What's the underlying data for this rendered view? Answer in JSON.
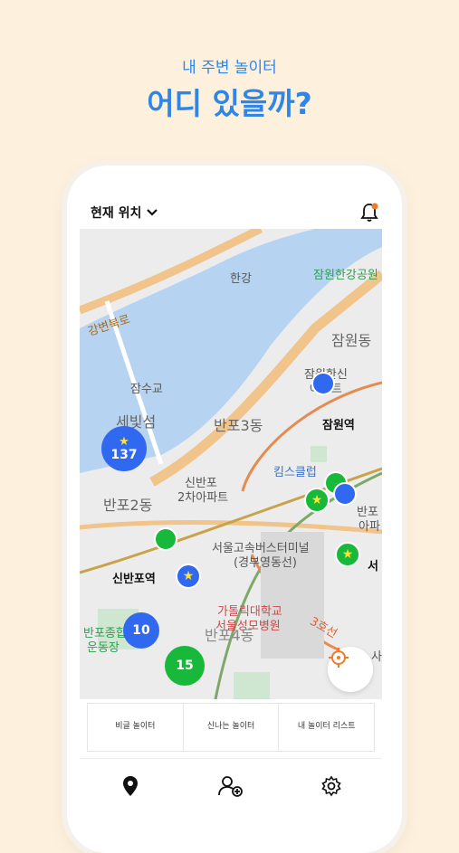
{
  "header": {
    "subtitle": "내 주변 놀이터",
    "headline": "어디 있을까?"
  },
  "app": {
    "location_label": "현재 위치"
  },
  "map": {
    "labels": {
      "hangang": "한강",
      "park_hangang": "잠원한강공원",
      "gangbyeon_road": "강변북로",
      "jamwon_dong": "잠원동",
      "jamwon_apt": "잠원한신",
      "jamwon_apt2": "아파트",
      "jamsugyo": "잠수교",
      "sebitseom": "세빛섬",
      "banpo3dong": "반포3동",
      "jamwon_station": "잠원역",
      "kids_club": "킴스클럽",
      "sinbanpo_apt": "신반포",
      "sinbanpo_apt2": "2차아파트",
      "banpo2dong": "반포2동",
      "banpo_apt_r": "반포",
      "banpo_apt_r2": "아파",
      "bus_terminal": "서울고속버스터미널",
      "bus_terminal2": "(경부영동선)",
      "sinbanpo_station": "신반포역",
      "catholic_univ": "가톨릭대학교",
      "catholic_hosp": "서울성모병원",
      "banpo4dong": "반포4동",
      "line3": "3호선",
      "banpo_sports": "반포종합",
      "banpo_sports2": "운동장",
      "side_s": "서",
      "side_a": "사"
    },
    "clusters": [
      {
        "count": "137",
        "color": "blue",
        "starred": true
      },
      {
        "count": "10",
        "color": "blue",
        "starred": false
      },
      {
        "count": "15",
        "color": "green",
        "starred": false
      }
    ]
  },
  "filters": [
    {
      "label": "비글 놀이터"
    },
    {
      "label": "신나는 놀이터"
    },
    {
      "label": "내 놀이터 리스트"
    }
  ],
  "nav": {
    "items": [
      {
        "icon": "location-pin-icon"
      },
      {
        "icon": "add-friend-icon"
      },
      {
        "icon": "settings-gear-icon"
      }
    ]
  },
  "colors": {
    "accent": "#2f86e8",
    "blue_marker": "#3168f0",
    "green_marker": "#18b83a",
    "background": "#fdf0dc"
  }
}
